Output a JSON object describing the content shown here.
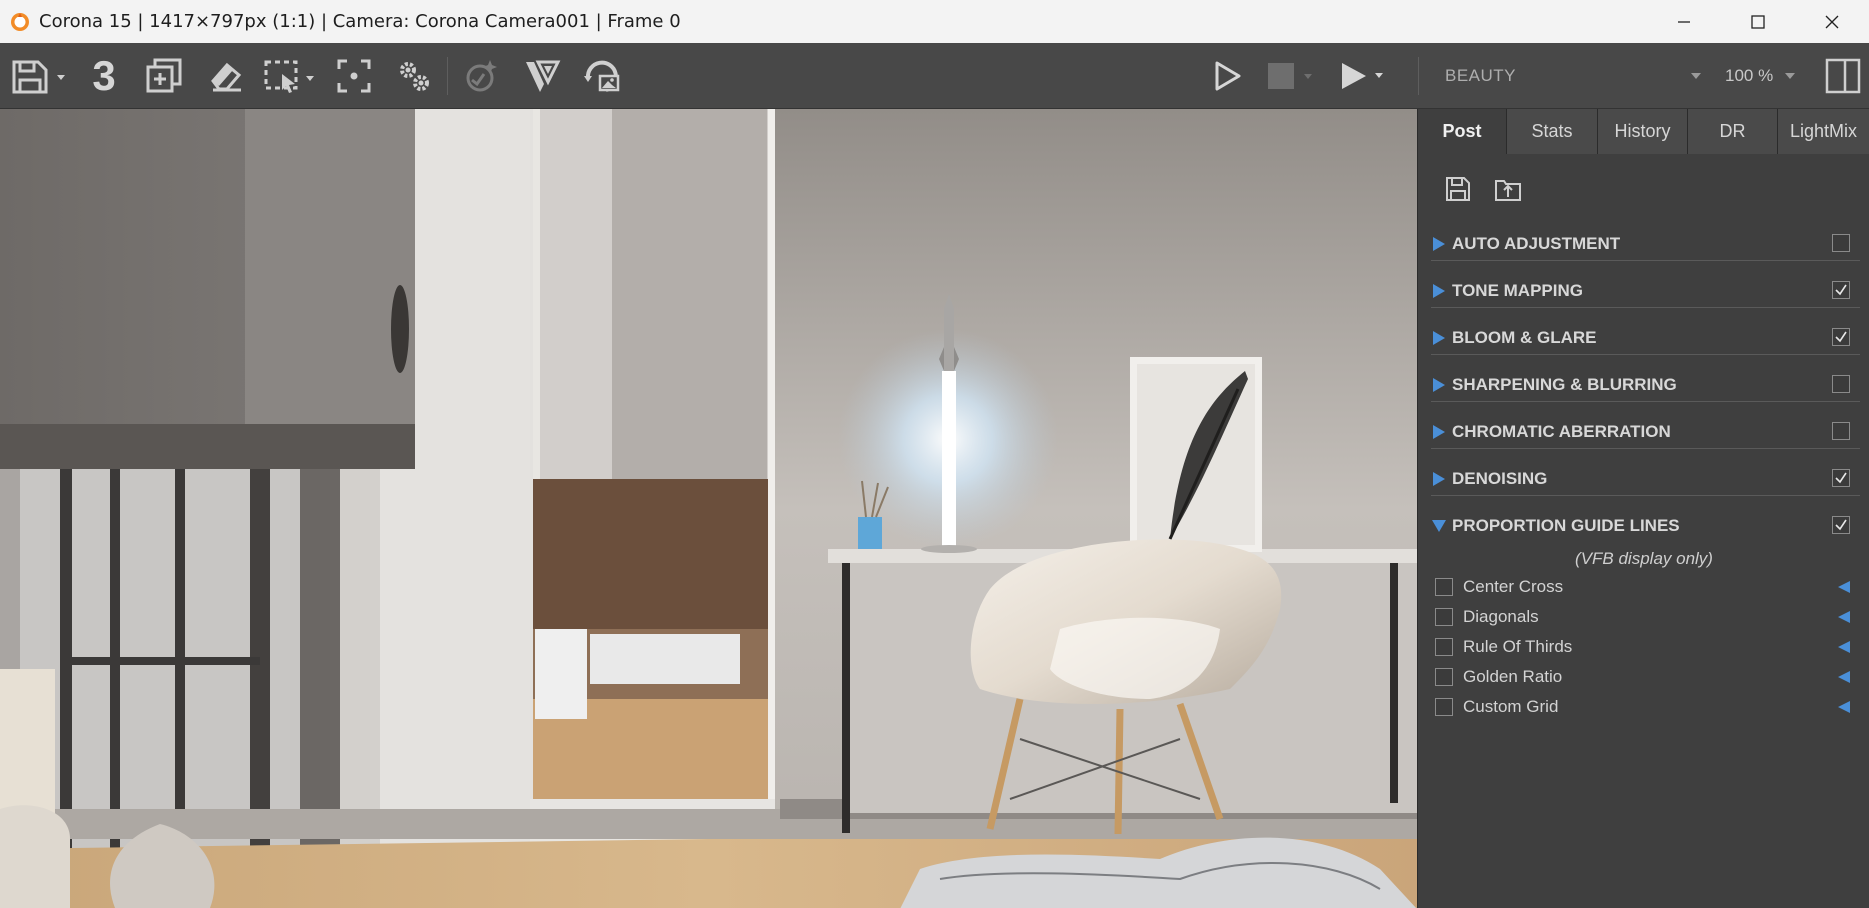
{
  "window": {
    "title": "Corona 15 | 1417×797px (1:1) | Camera: Corona Camera001 | Frame 0",
    "icon": "corona-logo-icon",
    "controls": [
      "minimize-icon",
      "maximize-icon",
      "close-icon"
    ]
  },
  "toolbar": {
    "save_icon": "save-icon",
    "history_count": "3",
    "buttons": [
      "save-icon",
      "clone-icon",
      "eraser-icon",
      "region-select-icon",
      "focus-icon",
      "settings-icon",
      "denoise-icon",
      "v-ray-icon",
      "render-image-icon",
      "play-icon",
      "stop-icon",
      "render-icon",
      "toggle-panel-icon"
    ],
    "render_pass": "BEAUTY",
    "zoom": "100 %"
  },
  "panel": {
    "tabs": [
      {
        "label": "Post",
        "active": true
      },
      {
        "label": "Stats",
        "active": false
      },
      {
        "label": "History",
        "active": false
      },
      {
        "label": "DR",
        "active": false
      },
      {
        "label": "LightMix",
        "active": false
      }
    ],
    "action_icons": [
      "save-settings-icon",
      "load-settings-icon"
    ],
    "sections": [
      {
        "label": "AUTO ADJUSTMENT",
        "enabled": false,
        "expanded": false
      },
      {
        "label": "TONE MAPPING",
        "enabled": true,
        "expanded": false
      },
      {
        "label": "BLOOM & GLARE",
        "enabled": true,
        "expanded": false
      },
      {
        "label": "SHARPENING & BLURRING",
        "enabled": false,
        "expanded": false
      },
      {
        "label": "CHROMATIC ABERRATION",
        "enabled": false,
        "expanded": false
      },
      {
        "label": "DENOISING",
        "enabled": true,
        "expanded": false
      },
      {
        "label": "PROPORTION GUIDE LINES",
        "enabled": true,
        "expanded": true
      }
    ],
    "guide_note": "(VFB display only)",
    "guides": [
      {
        "label": "Center Cross",
        "checked": false
      },
      {
        "label": "Diagonals",
        "checked": false
      },
      {
        "label": "Rule Of Thirds",
        "checked": false
      },
      {
        "label": "Golden Ratio",
        "checked": false
      },
      {
        "label": "Custom Grid",
        "checked": false
      }
    ]
  },
  "colors": {
    "accent_arrow": "#4a8fd8",
    "panel_bg": "#3f3f3f",
    "toolbar_bg": "#484848",
    "titlebar_bg": "#f3f3f3"
  }
}
